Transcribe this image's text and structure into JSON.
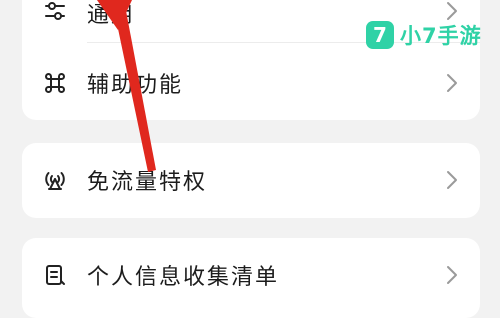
{
  "settings": {
    "items": [
      {
        "label": "通用",
        "icon": "sliders-icon"
      },
      {
        "label": "辅助功能",
        "icon": "command-icon"
      },
      {
        "label": "免流量特权",
        "icon": "signal-antenna-icon"
      },
      {
        "label": "个人信息收集清单",
        "icon": "document-list-icon"
      }
    ]
  },
  "watermark": {
    "badge": "7",
    "text": "小7手游",
    "color": "#2fd2a6"
  },
  "annotation": {
    "arrow_color": "#e0281e"
  }
}
